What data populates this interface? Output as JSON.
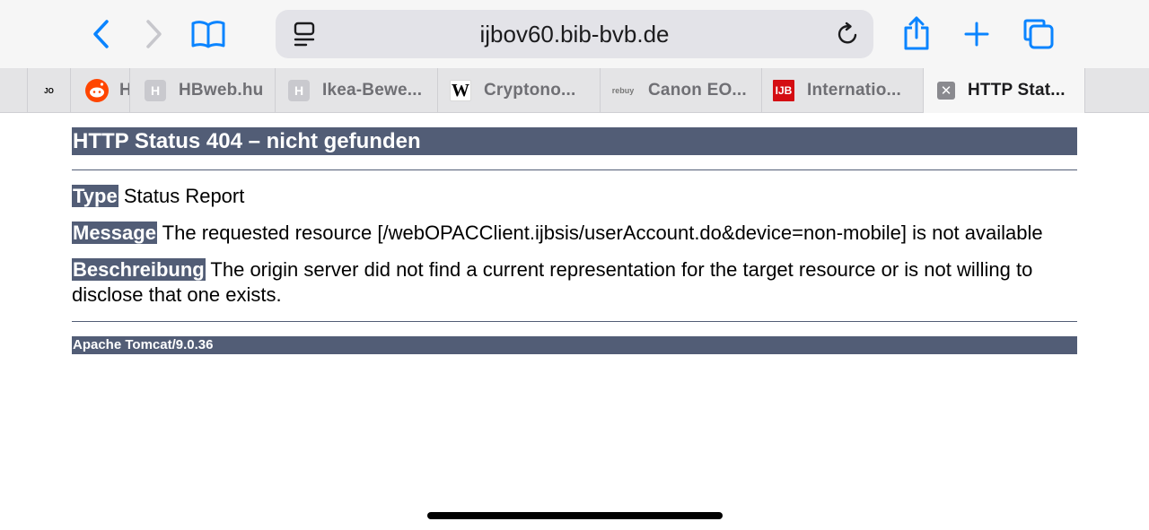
{
  "browser": {
    "address": "ijbov60.bib-bvb.de",
    "tabs": [
      {
        "label": "H"
      },
      {
        "label": "HBweb.hu",
        "favicon": "H"
      },
      {
        "label": "Ikea-Bewe...",
        "favicon": "H"
      },
      {
        "label": "Cryptono...",
        "favicon": "W"
      },
      {
        "label": "Canon EO...",
        "favicon": "rebuy"
      },
      {
        "label": "Internatio...",
        "favicon": "IJB"
      },
      {
        "label": "HTTP Stat...",
        "favicon": "close-icon",
        "active": true
      }
    ],
    "first_tab_icon": "JO"
  },
  "page": {
    "title": "HTTP Status 404 – nicht gefunden",
    "type_label": "Type",
    "type_value": "Status Report",
    "message_label": "Message",
    "message_value": "The requested resource [/webOPACClient.ijbsis/userAccount.do&device=non-mobile] is not available",
    "description_label": "Beschreibung",
    "description_value": "The origin server did not find a current representation for the target resource or is not willing to disclose that one exists.",
    "footer": "Apache Tomcat/9.0.36"
  },
  "colors": {
    "accent": "#525d76",
    "ios_blue": "#0a84ff"
  }
}
